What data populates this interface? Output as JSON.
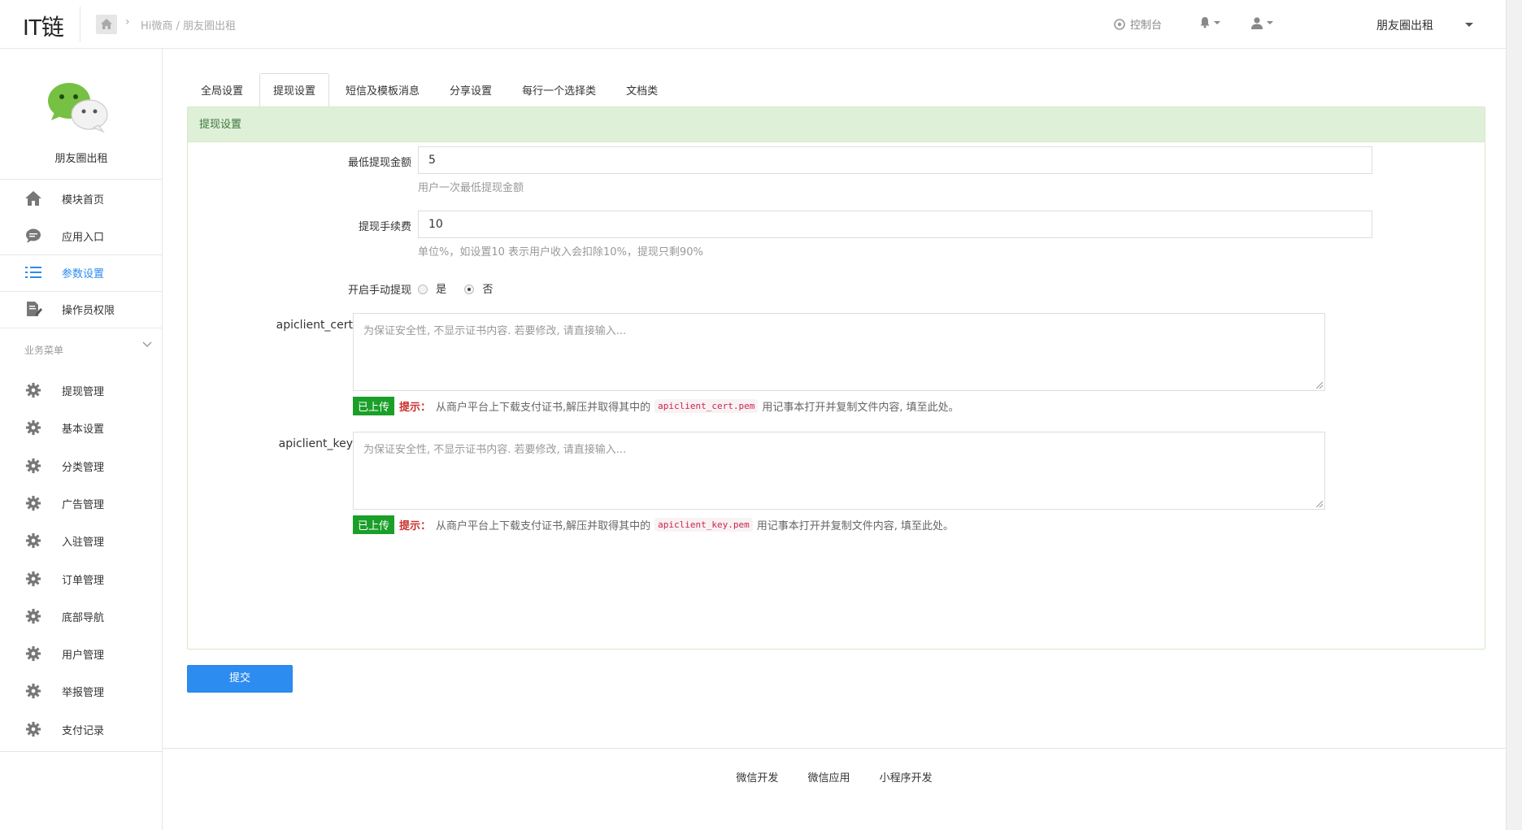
{
  "header": {
    "logo": "IT链",
    "breadcrumb": "Hi微商 / 朋友圈出租",
    "console": "控制台",
    "account": "朋友圈出租"
  },
  "sidebar": {
    "brand_name": "朋友圈出租",
    "items": [
      {
        "label": "模块首页",
        "icon": "home-icon"
      },
      {
        "label": "应用入口",
        "icon": "chat-bubble-icon"
      },
      {
        "label": "参数设置",
        "icon": "list-icon"
      },
      {
        "label": "操作员权限",
        "icon": "edit-doc-icon"
      }
    ],
    "group_title": "业务菜单",
    "group_items": [
      {
        "label": "提现管理"
      },
      {
        "label": "基本设置"
      },
      {
        "label": "分类管理"
      },
      {
        "label": "广告管理"
      },
      {
        "label": "入驻管理"
      },
      {
        "label": "订单管理"
      },
      {
        "label": "底部导航"
      },
      {
        "label": "用户管理"
      },
      {
        "label": "举报管理"
      },
      {
        "label": "支付记录"
      }
    ]
  },
  "tabs": [
    {
      "label": "全局设置",
      "active": false
    },
    {
      "label": "提现设置",
      "active": true
    },
    {
      "label": "短信及模板消息",
      "active": false
    },
    {
      "label": "分享设置",
      "active": false
    },
    {
      "label": "每行一个选择类",
      "active": false
    },
    {
      "label": "文档类",
      "active": false
    }
  ],
  "panel": {
    "title": "提现设置",
    "min_amount": {
      "label": "最低提现金额",
      "value": "5",
      "help": "用户一次最低提现金额"
    },
    "fee": {
      "label": "提现手续费",
      "value": "10",
      "help": "单位%，如设置10 表示用户收入会扣除10%，提现只剩90%"
    },
    "manual": {
      "label": "开启手动提现",
      "yes": "是",
      "no": "否",
      "selected": "否"
    },
    "cert": {
      "label": "apiclient_cert",
      "placeholder": "为保证安全性, 不显示证书内容. 若要修改, 请直接输入...",
      "badge": "已上传",
      "hint_label": "提示：",
      "hint_prefix": "从商户平台上下载支付证书,解压并取得其中的",
      "file": "apiclient_cert.pem",
      "hint_suffix": "用记事本打开并复制文件内容, 填至此处。"
    },
    "key": {
      "label": "apiclient_key",
      "placeholder": "为保证安全性, 不显示证书内容. 若要修改, 请直接输入...",
      "badge": "已上传",
      "hint_label": "提示：",
      "hint_prefix": "从商户平台上下载支付证书,解压并取得其中的",
      "file": "apiclient_key.pem",
      "hint_suffix": "用记事本打开并复制文件内容, 填至此处。"
    }
  },
  "submit_label": "提交",
  "footer": {
    "links": [
      "微信开发",
      "微信应用",
      "小程序开发"
    ]
  },
  "colors": {
    "accent": "#2d8cf0",
    "panel_head_bg": "#dff0d8",
    "panel_head_text": "#3c763d",
    "uploaded_badge": "#1a9f29",
    "hint_red": "#c9302c"
  }
}
